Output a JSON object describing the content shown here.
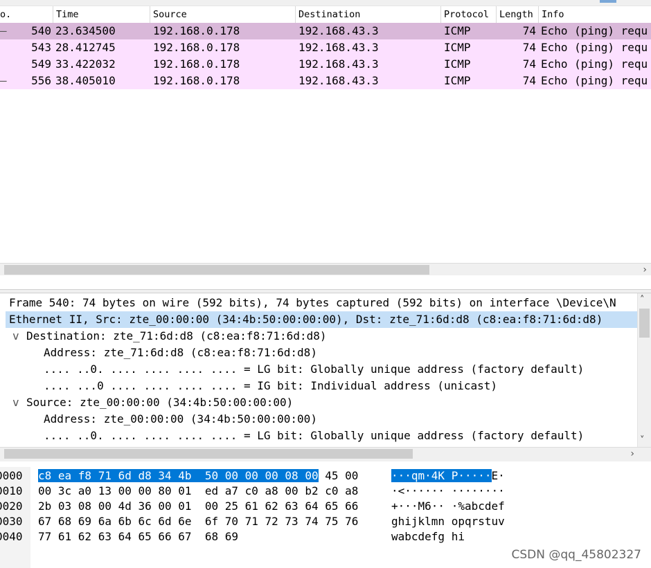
{
  "packet_list": {
    "columns": [
      "o.",
      "Time",
      "Source",
      "Destination",
      "Protocol",
      "Length",
      "Info"
    ],
    "rows": [
      {
        "no": "540",
        "time": "23.634500",
        "source": "192.168.0.178",
        "destination": "192.168.43.3",
        "protocol": "ICMP",
        "length": "74",
        "info": "Echo (ping) requ",
        "selected": true
      },
      {
        "no": "543",
        "time": "28.412745",
        "source": "192.168.0.178",
        "destination": "192.168.43.3",
        "protocol": "ICMP",
        "length": "74",
        "info": "Echo (ping) requ",
        "selected": false
      },
      {
        "no": "549",
        "time": "33.422032",
        "source": "192.168.0.178",
        "destination": "192.168.43.3",
        "protocol": "ICMP",
        "length": "74",
        "info": "Echo (ping) requ",
        "selected": false
      },
      {
        "no": "556",
        "time": "38.405010",
        "source": "192.168.0.178",
        "destination": "192.168.43.3",
        "protocol": "ICMP",
        "length": "74",
        "info": "Echo (ping) requ",
        "selected": false
      }
    ],
    "row_color": "#fce0ff",
    "selected_row_color": "#d9b8d9"
  },
  "details": {
    "lines": [
      {
        "prefix": "",
        "text": "Frame 540: 74 bytes on wire (592 bits), 74 bytes captured (592 bits) on interface \\Device\\N",
        "highlight": false
      },
      {
        "prefix": "·",
        "text": "Ethernet II, Src: zte_00:00:00 (34:4b:50:00:00:00), Dst: zte_71:6d:d8 (c8:ea:f8:71:6d:d8)",
        "highlight": true
      },
      {
        "prefix": "v",
        "text": "Destination: zte_71:6d:d8 (c8:ea:f8:71:6d:d8)",
        "highlight": false
      },
      {
        "prefix": "",
        "text": "Address: zte_71:6d:d8 (c8:ea:f8:71:6d:d8)",
        "highlight": false
      },
      {
        "prefix": "",
        "text": ".... ..0. .... .... .... .... = LG bit: Globally unique address (factory default)",
        "highlight": false
      },
      {
        "prefix": "",
        "text": ".... ...0 .... .... .... .... = IG bit: Individual address (unicast)",
        "highlight": false
      },
      {
        "prefix": "v",
        "text": "Source: zte_00:00:00 (34:4b:50:00:00:00)",
        "highlight": false
      },
      {
        "prefix": "",
        "text": "Address: zte_00:00:00 (34:4b:50:00:00:00)",
        "highlight": false
      },
      {
        "prefix": "",
        "text": ".... ..0. .... .... .... .... = LG bit: Globally unique address (factory default)",
        "highlight": false
      }
    ],
    "highlight_color": "#c5dff7"
  },
  "bytes": {
    "rows": [
      {
        "offset": "0000",
        "hex_sel": "c8 ea f8 71 6d d8 34 4b  50 00 00 00 08 00",
        "hex_rest": " 45 00",
        "ascii_sel": "···qm·4K P·····",
        "ascii_rest": "E·"
      },
      {
        "offset": "0010",
        "hex_sel": "",
        "hex_rest": "00 3c a0 13 00 00 80 01  ed a7 c0 a8 00 b2 c0 a8",
        "ascii_sel": "",
        "ascii_rest": "·<······ ········"
      },
      {
        "offset": "0020",
        "hex_sel": "",
        "hex_rest": "2b 03 08 00 4d 36 00 01  00 25 61 62 63 64 65 66",
        "ascii_sel": "",
        "ascii_rest": "+···M6·· ·%abcdef"
      },
      {
        "offset": "0030",
        "hex_sel": "",
        "hex_rest": "67 68 69 6a 6b 6c 6d 6e  6f 70 71 72 73 74 75 76",
        "ascii_sel": "",
        "ascii_rest": "ghijklmn opqrstuv"
      },
      {
        "offset": "0040",
        "hex_sel": "",
        "hex_rest": "77 61 62 63 64 65 66 67  68 69",
        "ascii_sel": "",
        "ascii_rest": "wabcdefg hi"
      }
    ]
  },
  "scroll_arrow_right": "›",
  "scroll_arrow_up": "˄",
  "scroll_arrow_down": "˅",
  "watermark": "CSDN @qq_45802327"
}
